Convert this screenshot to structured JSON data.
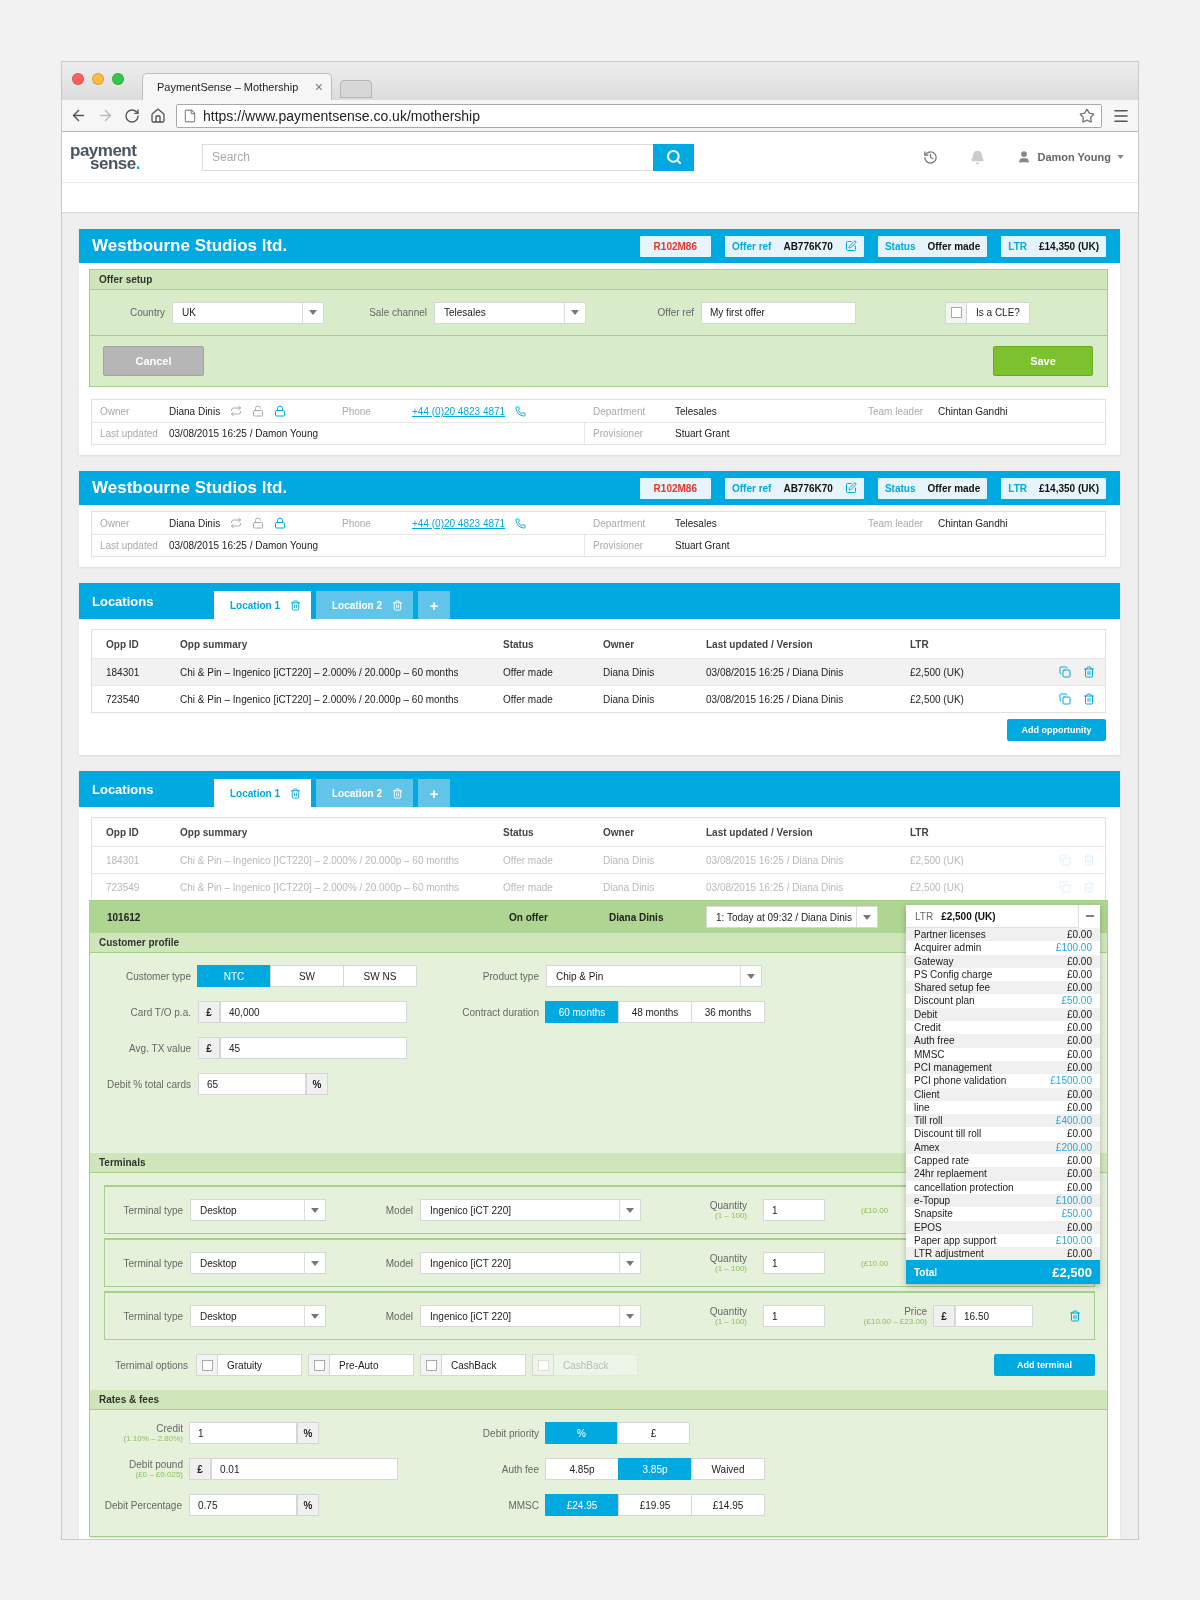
{
  "browser": {
    "tab_title": "PaymentSense – Mothership",
    "tab_close": "×",
    "url": "https://www.paymentsense.co.uk/mothership"
  },
  "header": {
    "logo_top": "payment",
    "logo_bottom": "sense",
    "logo_dot": ".",
    "search_placeholder": "Search",
    "user": "Damon Young"
  },
  "accounts": [
    {
      "title": "Westbourne Studios ltd.",
      "badges": [
        {
          "kind": "code",
          "value": "R102M86"
        },
        {
          "kind": "pair_edit",
          "label": "Offer ref",
          "value": "AB776K70"
        },
        {
          "kind": "pair",
          "label": "Status",
          "value": "Offer made"
        },
        {
          "kind": "pair",
          "label": "LTR",
          "value": "£14,350 (UK)"
        }
      ],
      "offer_setup": {
        "title": "Offer setup",
        "fields": [
          {
            "kind": "select",
            "label": "Country",
            "value": "UK"
          },
          {
            "kind": "select",
            "label": "Sale channel",
            "value": "Telesales"
          },
          {
            "kind": "input",
            "label": "Offer ref",
            "value": "My first offer"
          },
          {
            "kind": "checkbox",
            "label": "Is a CLE?",
            "checked": false
          }
        ],
        "cancel": "Cancel",
        "save": "Save"
      },
      "info": [
        [
          {
            "kind": "owner",
            "label": "Owner",
            "value": "Diana Dinis"
          },
          {
            "kind": "phone",
            "label": "Phone",
            "value": "+44 (0)20 4823 4871"
          },
          {
            "kind": "text",
            "label": "Department",
            "value": "Telesales"
          },
          {
            "kind": "text",
            "label": "Team leader",
            "value": "Chintan Gandhi"
          }
        ],
        [
          {
            "kind": "wide",
            "label": "Last updated",
            "value": "03/08/2015 16:25 / Damon Young"
          },
          {
            "kind": "wide",
            "label": "Provisioner",
            "value": "Stuart Grant"
          }
        ]
      ]
    },
    {
      "title": "Westbourne Studios ltd.",
      "badges": [
        {
          "kind": "code",
          "value": "R102M86"
        },
        {
          "kind": "pair_edit",
          "label": "Offer ref",
          "value": "AB776K70"
        },
        {
          "kind": "pair",
          "label": "Status",
          "value": "Offer made"
        },
        {
          "kind": "pair",
          "label": "LTR",
          "value": "£14,350 (UK)"
        }
      ],
      "info": [
        [
          {
            "kind": "owner",
            "label": "Owner",
            "value": "Diana Dinis"
          },
          {
            "kind": "phone",
            "label": "Phone",
            "value": "+44 (0)20 4823 4871"
          },
          {
            "kind": "text",
            "label": "Department",
            "value": "Telesales"
          },
          {
            "kind": "text",
            "label": "Team leader",
            "value": "Chintan Gandhi"
          }
        ],
        [
          {
            "kind": "wide",
            "label": "Last updated",
            "value": "03/08/2015 16:25 / Damon Young"
          },
          {
            "kind": "wide",
            "label": "Provisioner",
            "value": "Stuart Grant"
          }
        ]
      ]
    }
  ],
  "locations": [
    {
      "title": "Locations",
      "tabs": [
        {
          "label": "Location 1",
          "selected": true
        },
        {
          "label": "Location 2",
          "selected": false
        }
      ],
      "add_tab": "+",
      "columns": [
        "Opp ID",
        "Opp summary",
        "Status",
        "Owner",
        "Last updated / Version",
        "LTR"
      ],
      "rows": [
        {
          "id": "184301",
          "summary": "Chi & Pin – Ingenico [iCT220] – 2.000% / 20.000p – 60 months",
          "status": "Offer made",
          "owner": "Diana Dinis",
          "updated": "03/08/2015 16:25 / Diana Dinis",
          "ltr": "£2,500 (UK)",
          "hovered": true,
          "faded": false
        },
        {
          "id": "723540",
          "summary": "Chi & Pin – Ingenico [iCT220] – 2.000% / 20.000p – 60 months",
          "status": "Offer made",
          "owner": "Diana Dinis",
          "updated": "03/08/2015 16:25 / Diana Dinis",
          "ltr": "£2,500 (UK)",
          "hovered": false,
          "faded": false
        }
      ],
      "add_button": "Add opportunity"
    },
    {
      "title": "Locations",
      "tabs": [
        {
          "label": "Location 1",
          "selected": true
        },
        {
          "label": "Location 2",
          "selected": false
        }
      ],
      "add_tab": "+",
      "columns": [
        "Opp ID",
        "Opp summary",
        "Status",
        "Owner",
        "Last updated / Version",
        "LTR"
      ],
      "rows": [
        {
          "id": "184301",
          "summary": "Chi & Pin – Ingenico [ICT220] – 2.000% / 20.000p – 60 months",
          "status": "Offer made",
          "owner": "Diana Dinis",
          "updated": "03/08/2015 16:25 / Diana Dinis",
          "ltr": "£2,500 (UK)",
          "hovered": false,
          "faded": true
        },
        {
          "id": "723549",
          "summary": "Chi & Pin – Ingenico [ICT220] – 2.000% / 20.000p – 60 months",
          "status": "Offer made",
          "owner": "Diana Dinis",
          "updated": "03/08/2015 16:25 / Diana Dinis",
          "ltr": "£2,500 (UK)",
          "hovered": false,
          "faded": true
        }
      ],
      "expanded": {
        "id": "101612",
        "status": "On offer",
        "owner": "Diana Dinis",
        "version": "1: Today at 09:32 / Diana Dinis",
        "ltr": {
          "label": "LTR",
          "value": "£2,500 (UK)",
          "total_label": "Total",
          "total": "£2,500",
          "items": [
            {
              "name": "Partner licenses",
              "amount": "£0.00",
              "highlight": false
            },
            {
              "name": "Acquirer admin",
              "amount": "£100.00",
              "highlight": true
            },
            {
              "name": "Gateway",
              "amount": "£0.00",
              "highlight": false
            },
            {
              "name": "PS Config charge",
              "amount": "£0.00",
              "highlight": false
            },
            {
              "name": "Shared setup fee",
              "amount": "£0.00",
              "highlight": false
            },
            {
              "name": "Discount plan",
              "amount": "£50.00",
              "highlight": true
            },
            {
              "name": "Debit",
              "amount": "£0.00",
              "highlight": false
            },
            {
              "name": "Credit",
              "amount": "£0.00",
              "highlight": false
            },
            {
              "name": "Auth free",
              "amount": "£0.00",
              "highlight": false
            },
            {
              "name": "MMSC",
              "amount": "£0.00",
              "highlight": false
            },
            {
              "name": "PCI management",
              "amount": "£0.00",
              "highlight": false
            },
            {
              "name": "PCI phone validation",
              "amount": "£1500.00",
              "highlight": true
            },
            {
              "name": "Client",
              "amount": "£0.00",
              "highlight": false
            },
            {
              "name": "line",
              "amount": "£0.00",
              "highlight": false
            },
            {
              "name": "Till roll",
              "amount": "£400.00",
              "highlight": true
            },
            {
              "name": "Discount till roll",
              "amount": "£0.00",
              "highlight": false
            },
            {
              "name": "Amex",
              "amount": "£200.00",
              "highlight": true
            },
            {
              "name": "Capped rate",
              "amount": "£0.00",
              "highlight": false
            },
            {
              "name": "24hr replaement",
              "amount": "£0.00",
              "highlight": false
            },
            {
              "name": "cancellation protection",
              "amount": "£0.00",
              "highlight": false
            },
            {
              "name": "e-Topup",
              "amount": "£100.00",
              "highlight": true
            },
            {
              "name": "Snapsite",
              "amount": "£50.00",
              "highlight": true
            },
            {
              "name": "EPOS",
              "amount": "£0.00",
              "highlight": false
            },
            {
              "name": "Paper app support",
              "amount": "£100.00",
              "highlight": true
            },
            {
              "name": "LTR adjustment",
              "amount": "£0.00",
              "highlight": false
            }
          ]
        },
        "customer_profile": {
          "title": "Customer profile",
          "left": [
            {
              "kind": "segmented",
              "label": "Customer type",
              "options": [
                {
                  "label": "NTC",
                  "selected": true
                },
                {
                  "label": "SW",
                  "selected": false
                },
                {
                  "label": "SW NS",
                  "selected": false
                }
              ]
            },
            {
              "kind": "input",
              "label": "Card T/O p.a.",
              "prefix": "£",
              "value": "40,000"
            },
            {
              "kind": "input",
              "label": "Avg. TX value",
              "prefix": "£",
              "value": "45"
            },
            {
              "kind": "input",
              "label": "Debit % total cards",
              "suffix": "%",
              "value": "65"
            }
          ],
          "right": [
            {
              "kind": "select",
              "label": "Product type",
              "value": "Chip & Pin"
            },
            {
              "kind": "segmented",
              "label": "Contract duration",
              "options": [
                {
                  "label": "60 months",
                  "selected": true
                },
                {
                  "label": "48 months",
                  "selected": false
                },
                {
                  "label": "36 months",
                  "selected": false
                }
              ]
            }
          ]
        },
        "terminals": {
          "title": "Terminals",
          "rows": [
            {
              "type_label": "Terminal type",
              "type": "Desktop",
              "model_label": "Model",
              "model": "Ingenico [iCT 220]",
              "qty_label": "Quantity",
              "qty_hint": "(1 – 100)",
              "qty": "1",
              "price_hint": "(£10.00"
            },
            {
              "type_label": "Terminal type",
              "type": "Desktop",
              "model_label": "Model",
              "model": "Ingenico [iCT 220]",
              "qty_label": "Quantity",
              "qty_hint": "(1 – 100)",
              "qty": "1",
              "price_hint": "(£10.00"
            },
            {
              "type_label": "Terminal type",
              "type": "Desktop",
              "model_label": "Model",
              "model": "Ingenico [iCT 220]",
              "qty_label": "Quantity",
              "qty_hint": "(1 – 100)",
              "qty": "1",
              "price_label": "Price",
              "price_hint": "(£10.00 – £23.00)",
              "price_prefix": "£",
              "price": "16.50"
            }
          ],
          "options_label": "Ternimal options",
          "options": [
            {
              "label": "Gratuity",
              "checked": false,
              "disabled": false
            },
            {
              "label": "Pre-Auto",
              "checked": false,
              "disabled": false
            },
            {
              "label": "CashBack",
              "checked": false,
              "disabled": false
            },
            {
              "label": "CashBack",
              "checked": false,
              "disabled": true
            }
          ],
          "add": "Add terminal"
        },
        "rates": {
          "title": "Rates & fees",
          "rows": [
            [
              {
                "kind": "input",
                "label": "Credit",
                "hint": "(1.10% – 2.80%)",
                "value": "1",
                "suffix": "%"
              },
              {
                "kind": "segmented",
                "label": "Debit priority",
                "options": [
                  {
                    "label": "%",
                    "selected": true
                  },
                  {
                    "label": "£",
                    "selected": false
                  }
                ]
              }
            ],
            [
              {
                "kind": "input",
                "label": "Debit pound",
                "hint": "(£0 – £0.025)",
                "prefix": "£",
                "value": "0.01"
              },
              {
                "kind": "segmented",
                "label": "Auth fee",
                "options": [
                  {
                    "label": "4.85p",
                    "selected": false
                  },
                  {
                    "label": "3.85p",
                    "selected": true
                  },
                  {
                    "label": "Waived",
                    "selected": false
                  }
                ]
              }
            ],
            [
              {
                "kind": "input",
                "label": "Debit Percentage",
                "value": "0.75",
                "suffix": "%"
              },
              {
                "kind": "segmented",
                "label": "MMSC",
                "options": [
                  {
                    "label": "£24.95",
                    "selected": true
                  },
                  {
                    "label": "£19.95",
                    "selected": false
                  },
                  {
                    "label": "£14.95",
                    "selected": false
                  }
                ]
              }
            ]
          ]
        }
      }
    }
  ]
}
